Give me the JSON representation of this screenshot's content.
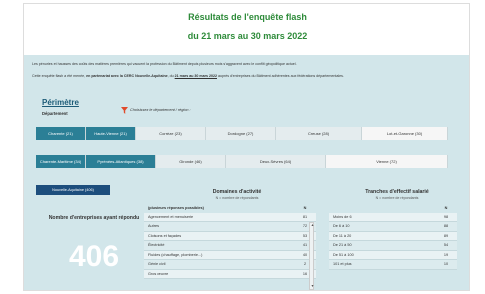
{
  "header": {
    "title_line1": "Résultats de l'enquête flash",
    "title_line2": "du 21 mars au 30 mars 2022"
  },
  "intro": {
    "paragraph1": "Les pénuries et hausses des coûts des matières premières qui vacuent la profession du Bâtiment depuis plusieurs mois s'aggravent avec le conflit géopolitique actuel.",
    "paragraph2_pre": "Cette enquête flash a été menée, ",
    "paragraph2_bold": "en partenariat avec la CERC Nouvelle-Aquitaine",
    "paragraph2_mid": ", du ",
    "paragraph2_dates": "21 mars au 30 mars 2022",
    "paragraph2_post": " auprès d'entreprises du Bâtiment adhérentes aux fédérations départementales."
  },
  "perimetre": {
    "title": "Périmètre",
    "dept_label": "Département",
    "filter_hint": "Choisissez le département / région :"
  },
  "departments_row1": [
    {
      "label": "Charente (21)",
      "selected": true
    },
    {
      "label": "Haute-Vienne (21)",
      "selected": true
    },
    {
      "label": "Corrèze (23)",
      "selected": false
    },
    {
      "label": "Dordogne (27)",
      "selected": false
    },
    {
      "label": "Creuse (28)",
      "selected": false
    },
    {
      "label": "Lot-et-Garonne (30)",
      "selected": false
    }
  ],
  "departments_row2": [
    {
      "label": "Charente-Maritime (34)",
      "selected": true
    },
    {
      "label": "Pyrénées-Atlantiques (38)",
      "selected": true
    },
    {
      "label": "Gironde (46)",
      "selected": false
    },
    {
      "label": "Deux-Sèvres (64)",
      "selected": false
    },
    {
      "label": "Vienne (72)",
      "selected": false
    }
  ],
  "region_button": "Nouvelle-Aquitaine (406)",
  "count": {
    "title": "Nombre d'entreprises ayant répondu",
    "value": "406"
  },
  "domaines": {
    "title": "Domaines d'activité",
    "subtitle": "N = nombre de répondants",
    "header_label": "(plusieurs réponses possibles)",
    "header_n": "N",
    "rows": [
      {
        "label": "Agencement et menuiserie",
        "n": "81"
      },
      {
        "label": "Autres",
        "n": "72"
      },
      {
        "label": "Cloisons et façades",
        "n": "53"
      },
      {
        "label": "Électricité",
        "n": "41"
      },
      {
        "label": "Fluides (chauffage, plomberie...)",
        "n": "40"
      },
      {
        "label": "Génie civil",
        "n": "2"
      },
      {
        "label": "Gros œuvre",
        "n": "16"
      }
    ]
  },
  "tranches": {
    "title": "Tranches d'effectif salarié",
    "subtitle": "N = nombre de répondants",
    "header_n": "N",
    "rows": [
      {
        "label": "Moins de 6",
        "n": "98"
      },
      {
        "label": "De 6 à 10",
        "n": "88"
      },
      {
        "label": "De 11 à 20",
        "n": "89"
      },
      {
        "label": "De 21 à 50",
        "n": "54"
      },
      {
        "label": "De 51 à 100",
        "n": "19"
      },
      {
        "label": "101 et plus",
        "n": "10"
      }
    ]
  }
}
